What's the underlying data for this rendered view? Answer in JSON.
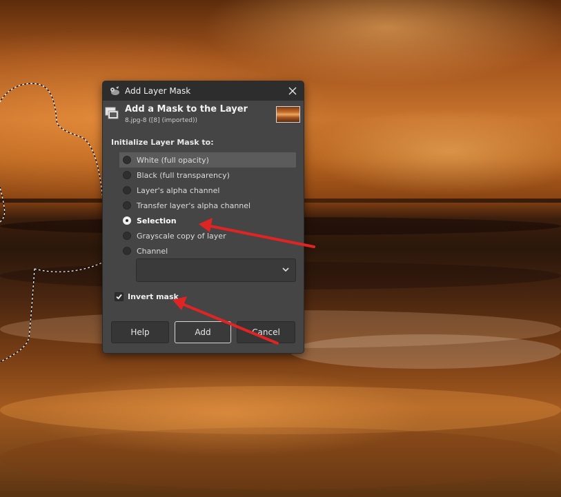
{
  "dialog": {
    "title": "Add Layer Mask",
    "header_title": "Add a Mask to the Layer",
    "header_subtitle": "8.jpg-8 ([8] (imported))",
    "section_label": "Initialize Layer Mask to:",
    "options": [
      {
        "label": "White (full opacity)",
        "selected": false
      },
      {
        "label": "Black (full transparency)",
        "selected": false
      },
      {
        "label": "Layer's alpha channel",
        "selected": false
      },
      {
        "label": "Transfer layer's alpha channel",
        "selected": false
      },
      {
        "label": "Selection",
        "selected": true
      },
      {
        "label": "Grayscale copy of layer",
        "selected": false
      },
      {
        "label": "Channel",
        "selected": false
      }
    ],
    "channel_value": "",
    "invert_mask": {
      "label": "Invert mask",
      "checked": true
    },
    "buttons": {
      "help": "Help",
      "add": "Add",
      "cancel": "Cancel"
    }
  },
  "icons": {
    "titlebar": "gimp-wilber-icon",
    "header": "layer-mask-icon",
    "close": "close-icon",
    "combo": "chevron-down-icon"
  },
  "colors": {
    "dialog_bg": "#454545",
    "titlebar_bg": "#2d2d2d",
    "annotation_arrow": "#e02424",
    "hover_row": "#5b5b5b"
  }
}
